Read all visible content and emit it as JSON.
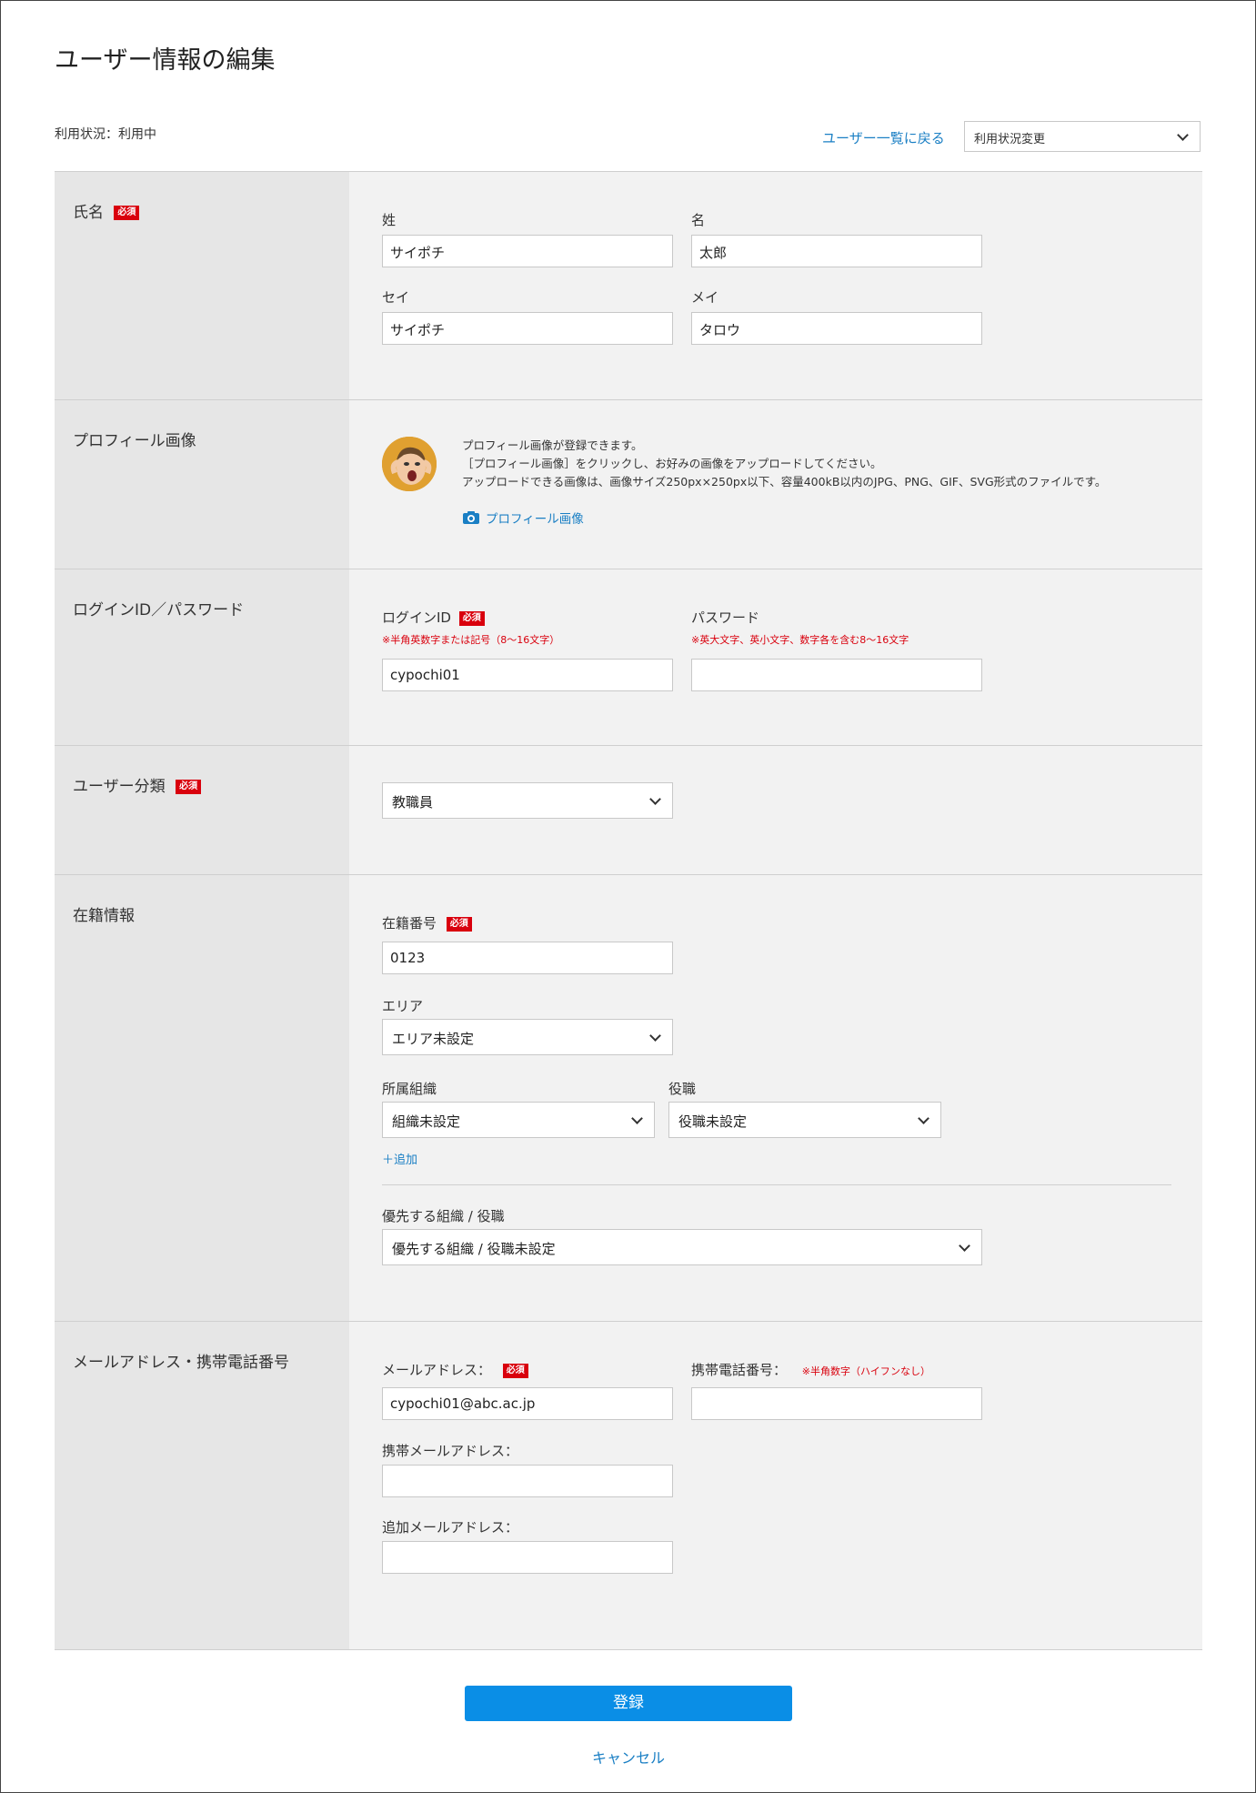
{
  "page_title": "ユーザー情報の編集",
  "status": "利用状況：利用中",
  "back_link": "ユーザー一覧に戻る",
  "status_select": "利用状況変更",
  "required_badge": "必須",
  "name": {
    "section_label": "氏名",
    "last_label": "姓",
    "last_value": "サイポチ",
    "first_label": "名",
    "first_value": "太郎",
    "last_kana_label": "セイ",
    "last_kana_value": "サイポチ",
    "first_kana_label": "メイ",
    "first_kana_value": "タロウ"
  },
  "profile": {
    "section_label": "プロフィール画像",
    "line1": "プロフィール画像が登録できます。",
    "line2": "［プロフィール画像］をクリックし、お好みの画像をアップロードしてください。",
    "line3": "アップロードできる画像は、画像サイズ250px×250px以下、容量400kB以内のJPG、PNG、GIF、SVG形式のファイルです。",
    "upload_link": "プロフィール画像"
  },
  "login": {
    "section_label": "ログインID／パスワード",
    "id_label": "ログインID",
    "id_note": "※半角英数字または記号（8〜16文字）",
    "id_value": "cypochi01",
    "pw_label": "パスワード",
    "pw_note": "※英大文字、英小文字、数字各を含む8〜16文字",
    "pw_value": ""
  },
  "user_type": {
    "section_label": "ユーザー分類",
    "value": "教職員"
  },
  "enrollment": {
    "section_label": "在籍情報",
    "number_label": "在籍番号",
    "number_value": "0123",
    "area_label": "エリア",
    "area_value": "エリア未設定",
    "org_label": "所属組織",
    "org_value": "組織未設定",
    "position_label": "役職",
    "position_value": "役職未設定",
    "add_link": "＋追加",
    "priority_label": "優先する組織 / 役職",
    "priority_value": "優先する組織 / 役職未設定"
  },
  "contact": {
    "section_label": "メールアドレス・携帯電話番号",
    "email_label": "メールアドレス：",
    "email_value": "cypochi01@abc.ac.jp",
    "phone_label": "携帯電話番号：",
    "phone_note": "※半角数字（ハイフンなし）",
    "phone_value": "",
    "mobile_email_label": "携帯メールアドレス：",
    "mobile_email_value": "",
    "extra_email_label": "追加メールアドレス：",
    "extra_email_value": ""
  },
  "submit_label": "登録",
  "cancel_label": "キャンセル",
  "colors": {
    "accent": "#0a8ee6",
    "link": "#1a7fc4",
    "required": "#d9000d"
  }
}
